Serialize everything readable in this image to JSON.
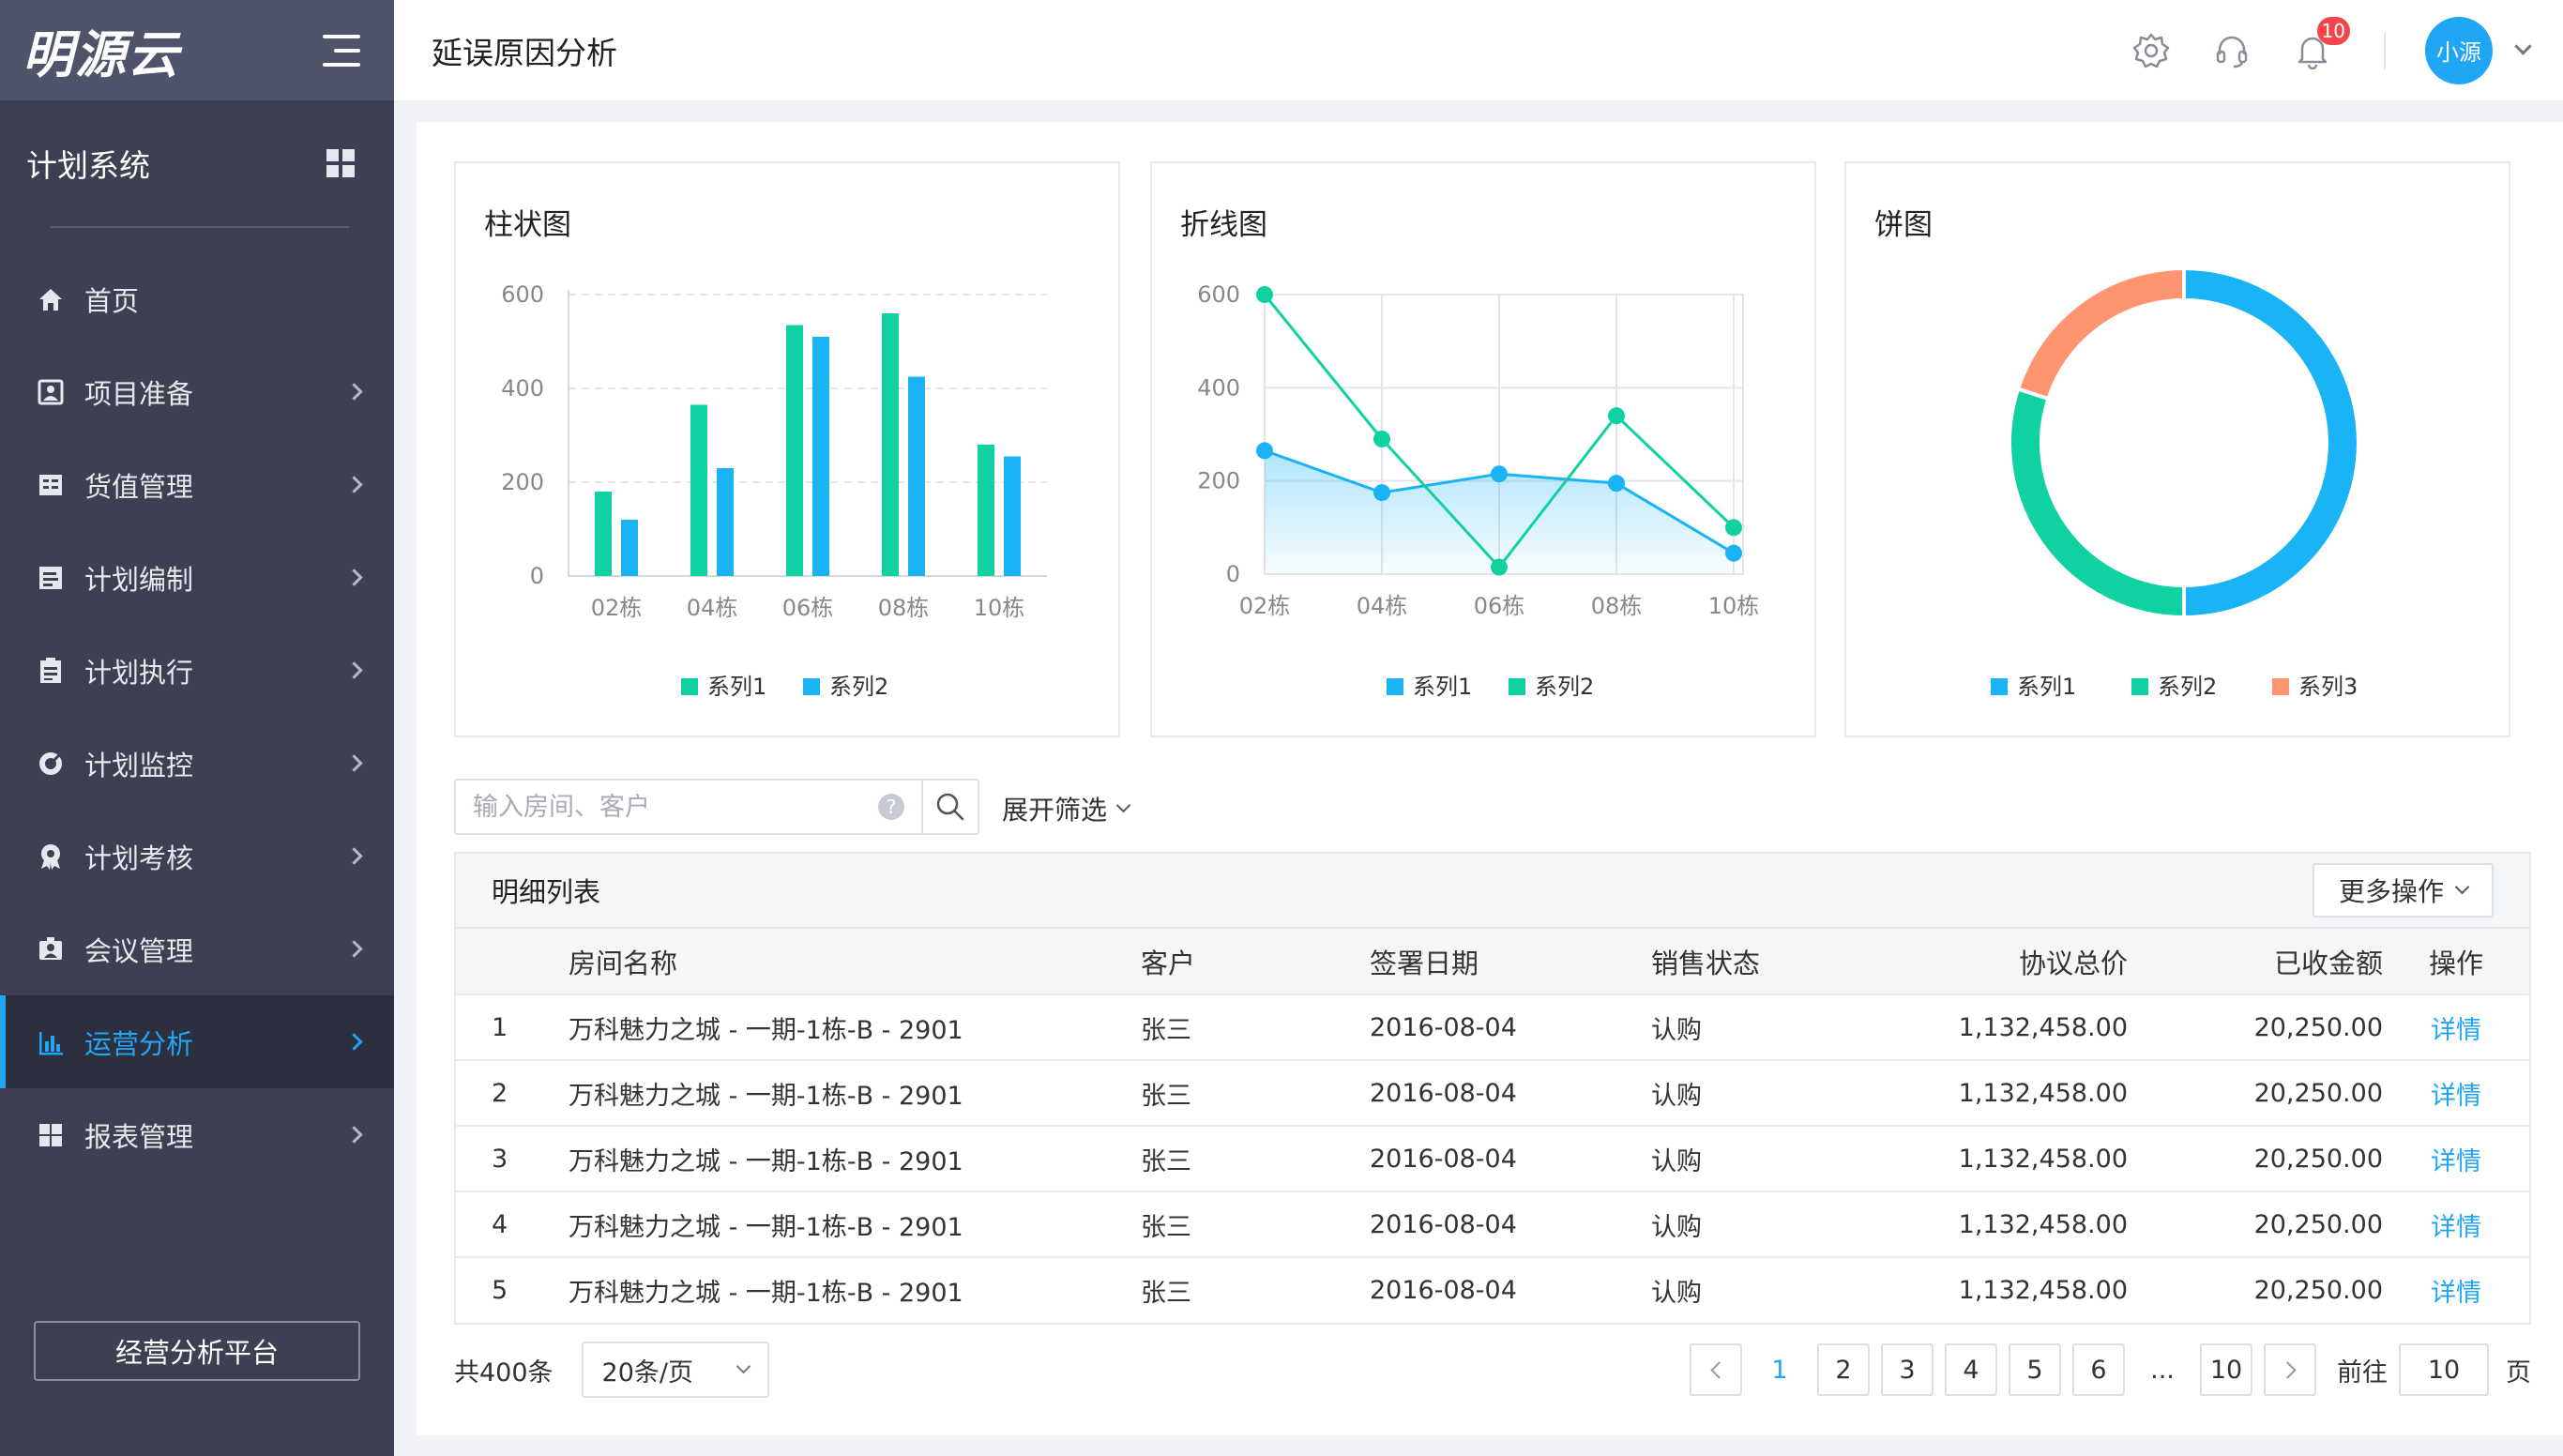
{
  "sidebar": {
    "logo": "明源云",
    "system_title": "计划系统",
    "items": [
      {
        "label": "首页",
        "icon": "home-icon"
      },
      {
        "label": "项目准备",
        "icon": "portrait-icon"
      },
      {
        "label": "货值管理",
        "icon": "ledger-icon"
      },
      {
        "label": "计划编制",
        "icon": "edit-doc-icon"
      },
      {
        "label": "计划执行",
        "icon": "list-doc-icon"
      },
      {
        "label": "计划监控",
        "icon": "monitor-icon"
      },
      {
        "label": "计划考核",
        "icon": "award-icon"
      },
      {
        "label": "会议管理",
        "icon": "meeting-icon"
      },
      {
        "label": "运营分析",
        "icon": "bar-chart-icon",
        "active": true
      },
      {
        "label": "报表管理",
        "icon": "report-icon"
      }
    ],
    "platform_button": "经营分析平台"
  },
  "header": {
    "title": "延误原因分析",
    "notification_count": "10",
    "user": "小源"
  },
  "charts": [
    {
      "card_title": "柱状图",
      "chart_data": {
        "type": "bar",
        "categories": [
          "02栋",
          "04栋",
          "06栋",
          "08栋",
          "10栋"
        ],
        "series": [
          {
            "name": "系列1",
            "values": [
              180,
              365,
              535,
              560,
              280
            ],
            "color": "#0fd1a1"
          },
          {
            "name": "系列2",
            "values": [
              120,
              230,
              510,
              425,
              255
            ],
            "color": "#1ab3f6"
          }
        ],
        "yticks": [
          "0",
          "200",
          "400",
          "600"
        ],
        "ylim": [
          0,
          600
        ],
        "legend": "bottom-center"
      }
    },
    {
      "card_title": "折线图",
      "chart_data": {
        "type": "line",
        "categories": [
          "02栋",
          "04栋",
          "06栋",
          "08栋",
          "10栋"
        ],
        "series": [
          {
            "name": "系列1",
            "values": [
              265,
              175,
              215,
              195,
              45
            ],
            "color": "#1ab3f6",
            "area": true
          },
          {
            "name": "系列2",
            "values": [
              600,
              290,
              15,
              340,
              100
            ],
            "color": "#0fd1a1"
          }
        ],
        "yticks": [
          "0",
          "200",
          "400",
          "600"
        ],
        "ylim": [
          0,
          600
        ],
        "grid": true,
        "legend": "bottom-center"
      }
    },
    {
      "card_title": "饼图",
      "chart_data": {
        "type": "pie",
        "donut": true,
        "slices": [
          {
            "name": "系列1",
            "value": 50,
            "color": "#1ab3f6"
          },
          {
            "name": "系列2",
            "value": 30,
            "color": "#0fd1a1"
          },
          {
            "name": "系列3",
            "value": 20,
            "color": "#fe9570"
          }
        ],
        "legend": "bottom-center"
      }
    }
  ],
  "search": {
    "placeholder": "输入房间、客户",
    "filter_toggle": "展开筛选"
  },
  "table": {
    "title": "明细列表",
    "more_button": "更多操作",
    "headers": [
      "",
      "房间名称",
      "客户",
      "签署日期",
      "销售状态",
      "协议总价",
      "已收金额",
      "操作"
    ],
    "rows": [
      {
        "idx": "1",
        "room": "万科魅力之城 - 一期-1栋-B - 2901",
        "customer": "张三",
        "date": "2016-08-04",
        "status": "认购",
        "total": "1,132,458.00",
        "received": "20,250.00",
        "action": "详情"
      },
      {
        "idx": "2",
        "room": "万科魅力之城 - 一期-1栋-B - 2901",
        "customer": "张三",
        "date": "2016-08-04",
        "status": "认购",
        "total": "1,132,458.00",
        "received": "20,250.00",
        "action": "详情"
      },
      {
        "idx": "3",
        "room": "万科魅力之城 - 一期-1栋-B - 2901",
        "customer": "张三",
        "date": "2016-08-04",
        "status": "认购",
        "total": "1,132,458.00",
        "received": "20,250.00",
        "action": "详情"
      },
      {
        "idx": "4",
        "room": "万科魅力之城 - 一期-1栋-B - 2901",
        "customer": "张三",
        "date": "2016-08-04",
        "status": "认购",
        "total": "1,132,458.00",
        "received": "20,250.00",
        "action": "详情"
      },
      {
        "idx": "5",
        "room": "万科魅力之城 - 一期-1栋-B - 2901",
        "customer": "张三",
        "date": "2016-08-04",
        "status": "认购",
        "total": "1,132,458.00",
        "received": "20,250.00",
        "action": "详情"
      }
    ]
  },
  "pagination": {
    "total": "共400条",
    "page_size": "20条/页",
    "pages": [
      "1",
      "2",
      "3",
      "4",
      "5",
      "6"
    ],
    "ellipsis": "...",
    "last_page": "10",
    "current": "1",
    "goto_label": "前往",
    "goto_value": "10",
    "goto_unit": "页"
  },
  "colors": {
    "accent": "#1fa6f5",
    "sidebar_bg": "#3c4052",
    "green": "#0fd1a1",
    "orange": "#fe9570"
  }
}
